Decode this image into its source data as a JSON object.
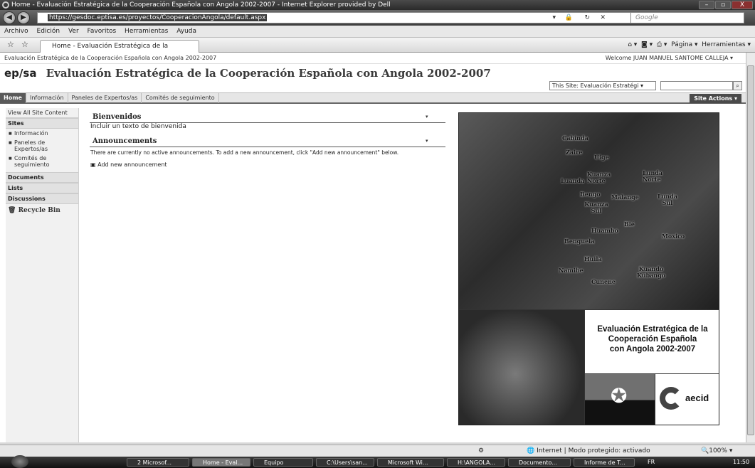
{
  "window": {
    "title": "Home - Evaluación Estratégica de la Cooperación Española con Angola 2002-2007 - Internet Explorer provided by Dell",
    "controls": [
      "–",
      "▫",
      "X"
    ]
  },
  "browser": {
    "address": "https://gesdoc.eptisa.es/proyectos/CooperacionAngola/default.aspx",
    "search_placeholder": "Google",
    "menu": [
      "Archivo",
      "Edición",
      "Ver",
      "Favoritos",
      "Herramientas",
      "Ayuda"
    ],
    "tab_label": "Home - Evaluación Estratégica de la Cooperación...",
    "page_menu": "Página",
    "tools_menu": "Herramientas"
  },
  "sharepoint": {
    "breadcrumb": "Evaluación Estratégica de la Cooperación Española con Angola 2002-2007",
    "welcome": "Welcome JUAN MANUEL SANTOME CALLEJA ▾",
    "logo": "ep/sa",
    "site_title": "Evaluación Estratégica de la Cooperación Española con Angola 2002-2007",
    "scope_selector": "This Site: Evaluación Estratégi",
    "nav_tabs": [
      "Home",
      "Información",
      "Paneles de Expertos/as",
      "Comités de seguimiento"
    ],
    "site_actions": "Site Actions ▾"
  },
  "quick_launch": {
    "view_all": "View All Site Content",
    "sites_heading": "Sites",
    "sites": [
      "Información",
      "Paneles de Expertos/as",
      "Comités de seguimiento"
    ],
    "documents": "Documents",
    "lists": "Lists",
    "discussions": "Discussions",
    "recycle_bin": "Recycle Bin"
  },
  "main": {
    "welcome_title": "Bienvenidos",
    "welcome_text": "Incluir un texto de bienvenida",
    "announcements_title": "Announcements",
    "announcements_empty": "There are currently no active announcements. To add a new announcement, click \"Add new announcement\" below.",
    "add_announcement": "Add new announcement"
  },
  "banner": {
    "map_labels": [
      "Cabinda",
      "Zaire",
      "Uige",
      "Luanda",
      "Kuanza Norte",
      "Lunda Norte",
      "Bengo",
      "Malange",
      "Lunda Sul",
      "Kuanza Sul",
      "Bié",
      "Huambo",
      "Benguela",
      "Moxico",
      "Huila",
      "Namibe",
      "Kuando Kubango",
      "Cunene"
    ],
    "title_lines": [
      "Evaluación Estratégica de la",
      "Cooperación Española",
      "con Angola 2002-2007"
    ],
    "aecid": "aecid"
  },
  "status": {
    "protected_mode": "Internet | Modo protegido: activado",
    "zoom": "100%"
  },
  "taskbar": {
    "items": [
      "2 Microsof...",
      "Home - Eval...",
      "Equipo",
      "C:\\Users\\san...",
      "Microsoft Wi...",
      "H:\\ANGOLA...",
      "Documento...",
      "Informe de T..."
    ],
    "lang": "FR",
    "clock": "11:50"
  }
}
